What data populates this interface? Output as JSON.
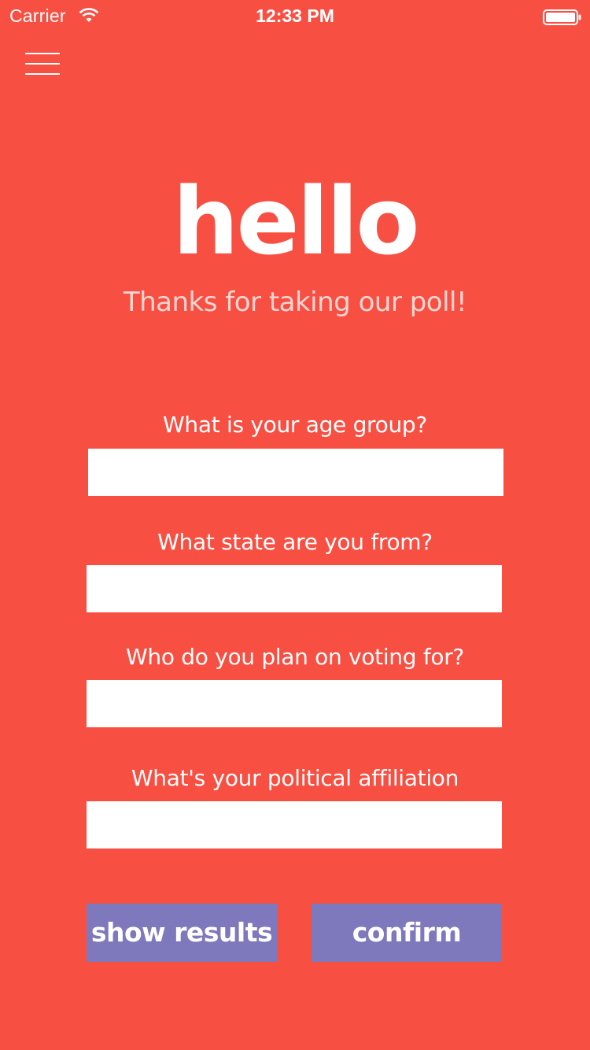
{
  "status_bar": {
    "carrier": "Carrier",
    "time": "12:33 PM",
    "wifi_icon": "wifi-icon",
    "battery_icon": "battery-icon"
  },
  "menu": {
    "icon": "hamburger-menu-icon"
  },
  "header": {
    "title": "hello",
    "subtitle": "Thanks for taking our poll!"
  },
  "questions": [
    {
      "label": "What is your age group?",
      "value": "",
      "placeholder": ""
    },
    {
      "label": "What state are you from?",
      "value": "",
      "placeholder": ""
    },
    {
      "label": "Who do you plan on voting for?",
      "value": "",
      "placeholder": ""
    },
    {
      "label": "What's your political affiliation",
      "value": "",
      "placeholder": ""
    }
  ],
  "buttons": {
    "show_results": "show results",
    "confirm": "confirm"
  },
  "colors": {
    "background": "#F84F43",
    "button": "#7E78BC",
    "subtitle": "#F7D6D2",
    "text": "#FFFFFF"
  }
}
